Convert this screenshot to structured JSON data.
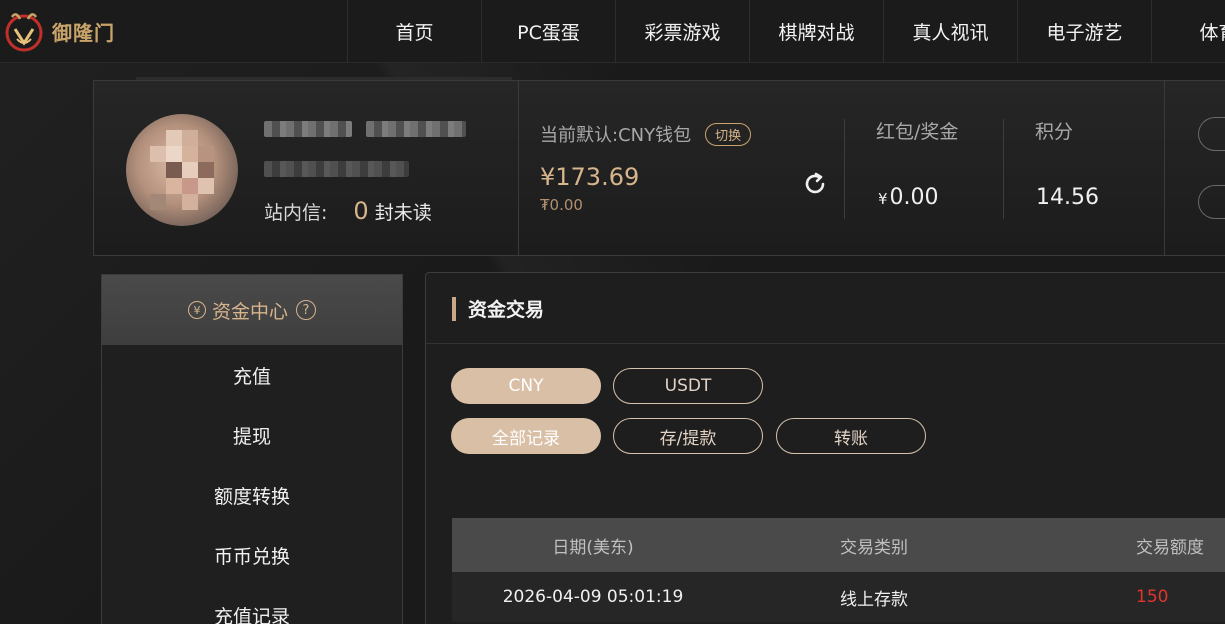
{
  "brand": {
    "logo_text": "御隆门"
  },
  "nav": {
    "items": [
      {
        "label": "首页"
      },
      {
        "label": "PC蛋蛋"
      },
      {
        "label": "彩票游戏"
      },
      {
        "label": "棋牌对战"
      },
      {
        "label": "真人视讯"
      },
      {
        "label": "电子游艺"
      },
      {
        "label": "体育"
      }
    ]
  },
  "profile": {
    "message_label": "站内信:",
    "message_count": "0",
    "message_unit": "封未读"
  },
  "wallet": {
    "default_label": "当前默认:",
    "wallet_name": "CNY钱包",
    "switch_label": "切换",
    "balance": "¥173.69",
    "sub_balance": "₮0.00"
  },
  "stats": {
    "bonus_label": "红包/奖金",
    "bonus_currency": "¥",
    "bonus_value": "0.00",
    "points_label": "积分",
    "points_value": "14.56"
  },
  "sidebar": {
    "title": "资金中心",
    "coin_glyph": "¥",
    "help_glyph": "?",
    "items": [
      {
        "label": "充值"
      },
      {
        "label": "提现"
      },
      {
        "label": "额度转换"
      },
      {
        "label": "币币兑换"
      },
      {
        "label": "充值记录"
      }
    ]
  },
  "panel": {
    "title": "资金交易",
    "currency_tabs": [
      {
        "label": "CNY",
        "active": true
      },
      {
        "label": "USDT",
        "active": false
      }
    ],
    "filter_tabs": [
      {
        "label": "全部记录",
        "active": true
      },
      {
        "label": "存/提款",
        "active": false
      },
      {
        "label": "转账",
        "active": false
      }
    ],
    "table": {
      "headers": [
        "日期(美东)",
        "交易类别",
        "交易额度"
      ],
      "rows": [
        {
          "date": "2026-04-09 05:01:19",
          "type": "线上存款",
          "amount": "150"
        }
      ]
    }
  },
  "colors": {
    "accent_gold": "#d6b48c",
    "pill_active": "#d9bfa6",
    "amount_red": "#e0342c"
  }
}
